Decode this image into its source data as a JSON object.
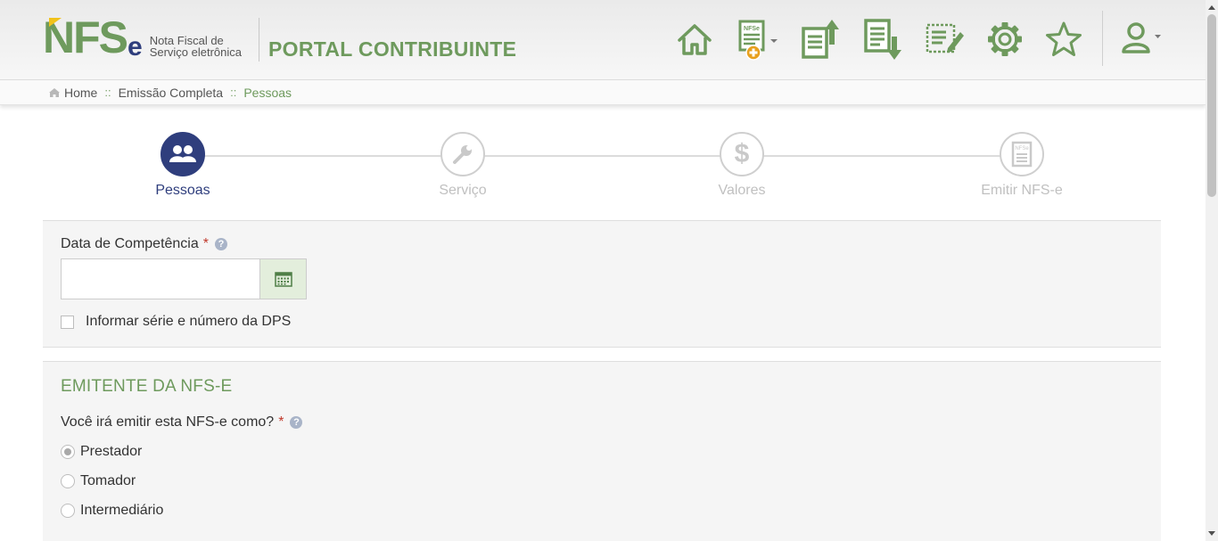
{
  "header": {
    "logo_text": "NFS",
    "logo_e": "e",
    "logo_subtitle_line1": "Nota Fiscal de",
    "logo_subtitle_line2": "Serviço eletrônica",
    "portal_title": "PORTAL CONTRIBUINTE",
    "toolbar": [
      {
        "name": "home-icon"
      },
      {
        "name": "new-nfse-icon",
        "badge_text": "NFSe"
      },
      {
        "name": "upload-document-icon"
      },
      {
        "name": "download-document-icon"
      },
      {
        "name": "edit-document-icon"
      },
      {
        "name": "gear-icon"
      },
      {
        "name": "star-icon"
      },
      {
        "name": "user-icon"
      }
    ]
  },
  "breadcrumb": {
    "home": "Home",
    "separator": "::",
    "level1": "Emissão Completa",
    "current": "Pessoas"
  },
  "steps": [
    {
      "label": "Pessoas",
      "icon": "people-icon",
      "active": true
    },
    {
      "label": "Serviço",
      "icon": "wrench-icon",
      "active": false
    },
    {
      "label": "Valores",
      "icon": "dollar-icon",
      "active": false
    },
    {
      "label": "Emitir NFS-e",
      "icon": "nfse-document-icon",
      "active": false,
      "icon_text": "NFSe"
    }
  ],
  "competencia": {
    "label": "Data de Competência",
    "required_mark": "*",
    "help_mark": "?",
    "value": "",
    "checkbox_label": "Informar série e número da DPS"
  },
  "emitente": {
    "section_title": "EMITENTE DA NFS-E",
    "question": "Você irá emitir esta NFS-e como?",
    "required_mark": "*",
    "help_mark": "?",
    "options": [
      {
        "label": "Prestador",
        "checked": true
      },
      {
        "label": "Tomador",
        "checked": false
      },
      {
        "label": "Intermediário",
        "checked": false
      }
    ]
  },
  "colors": {
    "brand_green": "#6e9a5d",
    "brand_navy": "#2f3e7d",
    "required_red": "#c0392b"
  }
}
